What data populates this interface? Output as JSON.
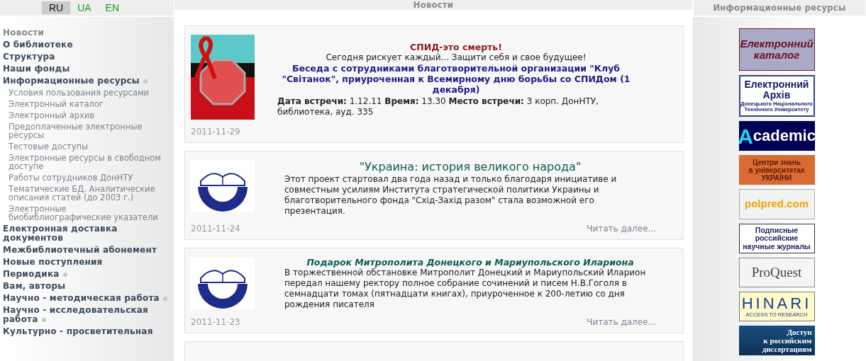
{
  "languages": [
    {
      "label": "RU",
      "selected": true
    },
    {
      "label": "UA",
      "selected": false
    },
    {
      "label": "EN",
      "selected": false
    }
  ],
  "sidebar": {
    "items": [
      {
        "label": "Новости",
        "has_children": false,
        "active": true
      },
      {
        "label": "О библиотеке",
        "has_children": false,
        "active": false
      },
      {
        "label": "Структура",
        "has_children": false,
        "active": false
      },
      {
        "label": "Наши фонды",
        "has_children": false,
        "active": false
      },
      {
        "label": "Информационные ресурсы",
        "has_children": true,
        "active": false,
        "children": [
          {
            "label": "Условия пользования ресурсами"
          },
          {
            "label": "Электронный каталог"
          },
          {
            "label": "Электронный архив"
          },
          {
            "label": "Предоплаченные электронные ресурсы"
          },
          {
            "label": "Тестовые доступы"
          },
          {
            "label": "Электронные ресурсы в свободном доступе"
          },
          {
            "label": "Работы сотрудников ДонНТУ"
          },
          {
            "label": "Тематические БД. Аналитические описания статей (до 2003 г.)"
          },
          {
            "label": "Электронные биобиблиографические указатели"
          }
        ]
      },
      {
        "label": "Електронная доставка документов",
        "has_children": false,
        "active": false
      },
      {
        "label": "Межбиблиотечный абонемент",
        "has_children": false,
        "active": false
      },
      {
        "label": "Новые поступления",
        "has_children": false,
        "active": false
      },
      {
        "label": "Периодика",
        "has_children": true,
        "active": false
      },
      {
        "label": "Вам, авторы",
        "has_children": false,
        "active": false
      },
      {
        "label": "Научно - методическая работа",
        "has_children": true,
        "active": false
      },
      {
        "label": "Научно - исследовательская работа",
        "has_children": true,
        "active": false
      },
      {
        "label": "Культурно - просветительная",
        "has_children": false,
        "active": false
      }
    ]
  },
  "center": {
    "title": "Новости",
    "news": [
      {
        "kind": "event",
        "title": "СПИД-это смерть!",
        "subtitle": "Сегодня рискует каждый... Защити себя и свое будущее!",
        "link": "Беседа с сотрудниками благотворительной организации \"Клуб \"Світанок\", приуроченная к Всемирному дню борьбы со СПИДом (1 декабря)",
        "details": "**Дата встречи:** 1.12.11   **Время:** 13.30  **Место встречи:** 3 корп. ДонНТУ, библиотека, ауд. 335",
        "date": "2011-11-29"
      },
      {
        "kind": "feature",
        "title": "\"Украина: история великого народа\"",
        "text": "Этот проект стартовал два года назад и только благодаря инициативе и совместным усилиям Института стратегической политики Украины и благотворительного фонда \"Схід-Захід разом\" стала возможной его презентация.",
        "date": "2011-11-24",
        "more": "Читать далее..."
      },
      {
        "kind": "gift",
        "title": "Подарок Митрополита Донецкого и Мариупольского Илариона",
        "text": "В торжественной обстановке Митрополит Донецкий и Мариупольский Иларион передал нашему ректору полное собрание сочинений и писем Н.В.Гоголя в семнадцати томах (пятнадцати книгах), приуроченное к 200-летию со дня рождения писателя",
        "date": "2011-11-23",
        "more": "Читать далее..."
      },
      {
        "kind": "empty"
      }
    ]
  },
  "resources": {
    "title": "Информационные ресурсы",
    "banners": [
      {
        "kind": "catalog",
        "lines": [
          "Електронний",
          "каталог"
        ]
      },
      {
        "kind": "archive",
        "lines": [
          "Електронний",
          "Архів",
          "Донецького Національного",
          "Технічного Університету"
        ]
      },
      {
        "kind": "academic",
        "lines": [
          "A",
          "cademic"
        ]
      },
      {
        "kind": "centres",
        "lines": [
          "Центри знань",
          "в університетах",
          "УКРАЇНИ"
        ]
      },
      {
        "kind": "polpred",
        "lines": [
          "polpred.com"
        ]
      },
      {
        "kind": "journals",
        "lines": [
          "Подписные",
          "российские",
          "научные журналы"
        ]
      },
      {
        "kind": "proquest",
        "lines": [
          "ProQuest"
        ]
      },
      {
        "kind": "hinari",
        "lines": [
          "HINARI",
          "ACCESS TO RESEARCH"
        ]
      },
      {
        "kind": "dissertations",
        "lines": [
          "Доступ",
          "к российским",
          "диссертациям"
        ]
      }
    ]
  }
}
